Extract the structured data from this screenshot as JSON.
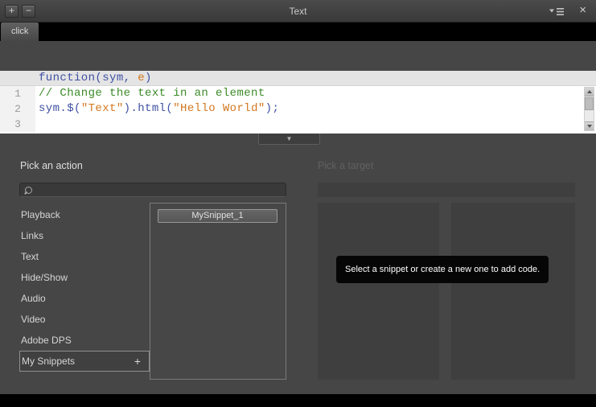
{
  "window": {
    "title": "Text",
    "controls": {
      "add": "+",
      "remove": "−",
      "close": "×"
    }
  },
  "tab": {
    "label": "click"
  },
  "editor": {
    "signature": [
      "function(sym, ",
      "e",
      ")"
    ],
    "lines": [
      {
        "num": "1",
        "code": [
          "// Change the text in an element"
        ]
      },
      {
        "num": "2",
        "code": [
          "sym.$(",
          "\"Text\"",
          ").html(",
          "\"Hello World\"",
          ");"
        ]
      },
      {
        "num": "3",
        "code": []
      }
    ]
  },
  "collapse": {
    "icon": "▼"
  },
  "actions": {
    "title": "Pick an action",
    "search_value": "",
    "categories": [
      "Playback",
      "Links",
      "Text",
      "Hide/Show",
      "Audio",
      "Video",
      "Adobe DPS"
    ],
    "my_snippets": {
      "label": "My Snippets",
      "add": "+"
    },
    "snippets": [
      "MySnippet_1"
    ]
  },
  "target": {
    "title": "Pick a target",
    "tooltip": "Select a snippet or create a new one to add code."
  },
  "colors": {
    "code_default": "#3f51a3",
    "code_string": "#d2771e",
    "code_comment": "#3c8a28",
    "panel_bg": "#464646",
    "dim_panel_bg": "#3f3f3f",
    "tooltip_bg": "#060606"
  }
}
